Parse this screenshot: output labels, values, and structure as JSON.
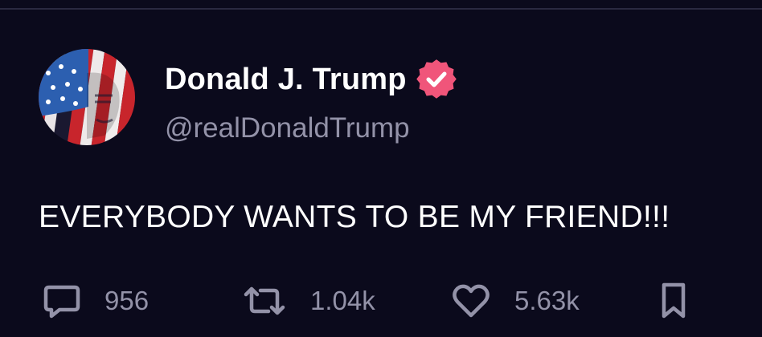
{
  "post": {
    "author": {
      "display_name": "Donald J. Trump",
      "handle": "@realDonaldTrump",
      "verified": true,
      "avatar_icon": "flag-portrait-avatar"
    },
    "text": "EVERYBODY WANTS TO BE MY FRIEND!!!",
    "actions": {
      "reply": {
        "icon": "reply-icon",
        "count": "956"
      },
      "repost": {
        "icon": "repost-icon",
        "count": "1.04k"
      },
      "like": {
        "icon": "heart-icon",
        "count": "5.63k"
      },
      "bookmark": {
        "icon": "bookmark-icon"
      }
    }
  },
  "colors": {
    "background": "#0b0a1c",
    "text_primary": "#ffffff",
    "text_secondary": "#9392a8",
    "verified_badge": "#f0557a"
  }
}
